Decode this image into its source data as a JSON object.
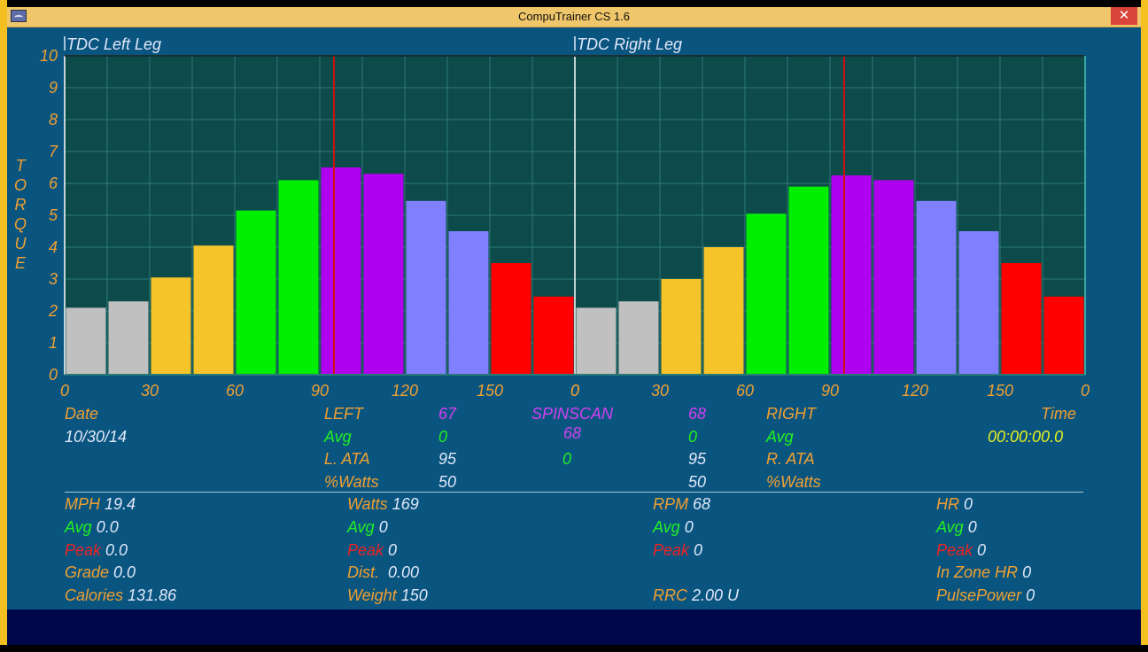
{
  "window": {
    "title": "CompuTrainer CS 1.6",
    "close_label": "✕"
  },
  "chart_data": [
    {
      "type": "bar",
      "title": "TDC Left Leg",
      "ylabel": "TORQUE",
      "ylim": [
        0,
        10
      ],
      "x_tick_labels": [
        "0",
        "30",
        "60",
        "90",
        "120",
        "150",
        "0"
      ],
      "values": [
        2.1,
        2.3,
        3.05,
        4.05,
        5.15,
        6.1,
        6.5,
        6.3,
        5.45,
        4.5,
        3.5,
        2.45
      ],
      "colors": [
        "#c0c0c0",
        "#c0c0c0",
        "#f4c42a",
        "#f4c42a",
        "#00ee00",
        "#00ee00",
        "#b000f0",
        "#b000f0",
        "#8080ff",
        "#8080ff",
        "#ff0000",
        "#ff0000"
      ],
      "marker_x": 95
    },
    {
      "type": "bar",
      "title": "TDC Right Leg",
      "ylim": [
        0,
        10
      ],
      "x_tick_labels": [
        "0",
        "30",
        "60",
        "90",
        "120",
        "150",
        "0"
      ],
      "values": [
        2.1,
        2.3,
        3.0,
        4.0,
        5.05,
        5.9,
        6.25,
        6.1,
        5.45,
        4.5,
        3.5,
        2.45
      ],
      "colors": [
        "#c0c0c0",
        "#c0c0c0",
        "#f4c42a",
        "#f4c42a",
        "#00ee00",
        "#00ee00",
        "#b000f0",
        "#b000f0",
        "#8080ff",
        "#8080ff",
        "#ff0000",
        "#ff0000"
      ],
      "marker_x": 95
    }
  ],
  "y_ticks": [
    "0",
    "1",
    "2",
    "3",
    "4",
    "5",
    "6",
    "7",
    "8",
    "9",
    "10"
  ],
  "y_axis_label": "TORQUE",
  "spinscan": {
    "date_label": "Date",
    "date_value": "10/30/14",
    "left_label": "LEFT",
    "left_value": "67",
    "spinscan_label": "SPINSCAN",
    "spinscan_value": "68",
    "right_value_top": "68",
    "right_label": "RIGHT",
    "time_label": "Time",
    "time_value": "00:00:00.0",
    "avg_label_left": "Avg",
    "avg_left_value": "0",
    "avg_right_value": "0",
    "avg_label_right": "Avg",
    "lata_label": "L. ATA",
    "lata_value": "95",
    "center_zero": "0",
    "rata_value": "95",
    "rata_label": "R. ATA",
    "pwatts_label_left": "%Watts",
    "pwatts_left_value": "50",
    "pwatts_right_value": "50",
    "pwatts_label_right": "%Watts"
  },
  "stats": {
    "mph_label": "MPH",
    "mph_value": "19.4",
    "mph_avg_label": "Avg",
    "mph_avg_value": "0.0",
    "mph_peak_label": "Peak",
    "mph_peak_value": "0.0",
    "grade_label": "Grade",
    "grade_value": "0.0",
    "calories_label": "Calories",
    "calories_value": "131.86",
    "watts_label": "Watts",
    "watts_value": "169",
    "watts_avg_label": "Avg",
    "watts_avg_value": "0",
    "watts_peak_label": "Peak",
    "watts_peak_value": "0",
    "dist_label": "Dist.",
    "dist_value": "0.00",
    "weight_label": "Weight",
    "weight_value": "150",
    "rpm_label": "RPM",
    "rpm_value": "68",
    "rpm_avg_label": "Avg",
    "rpm_avg_value": "0",
    "rpm_peak_label": "Peak",
    "rpm_peak_value": "0",
    "rrc_label": "RRC",
    "rrc_value": "2.00 U",
    "hr_label": "HR",
    "hr_value": "0",
    "hr_avg_label": "Avg",
    "hr_avg_value": "0",
    "hr_peak_label": "Peak",
    "hr_peak_value": "0",
    "inzone_label": "In Zone HR",
    "inzone_value": "0",
    "pulsepower_label": "PulsePower",
    "pulsepower_value": "0"
  },
  "colors": {
    "background": "#0a5580",
    "plot_bg": "#0d4a4a",
    "label_orange": "#f0a030",
    "avg_green": "#22ee22",
    "peak_red": "#ee2222",
    "spinscan_magenta": "#d040f0",
    "time_yellow": "#e6f020"
  }
}
